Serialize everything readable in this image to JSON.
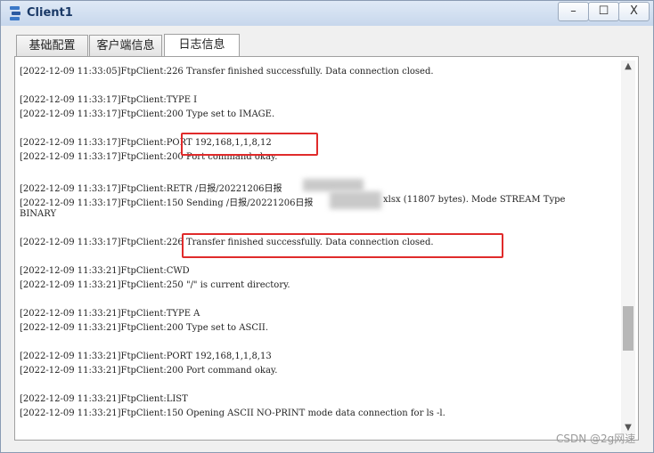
{
  "window": {
    "title": "Client1",
    "minimize_glyph": "–",
    "maximize_glyph": "☐",
    "close_glyph": "X"
  },
  "tabs": [
    {
      "label": "基础配置"
    },
    {
      "label": "客户端信息"
    },
    {
      "label": "日志信息"
    }
  ],
  "log_lines": [
    "[2022-12-09 11:33:05]FtpClient:226 Transfer finished successfully. Data connection closed.",
    "[2022-12-09 11:33:17]FtpClient:TYPE I",
    "[2022-12-09 11:33:17]FtpClient:200 Type set to IMAGE.",
    "[2022-12-09 11:33:17]FtpClient:PORT 192,168,1,1,8,12",
    "[2022-12-09 11:33:17]FtpClient:200 Port command okay.",
    "[2022-12-09 11:33:17]FtpClient:RETR /日报/20221206日报",
    "[2022-12-09 11:33:17]FtpClient:150 Sending /日报/20221206日报",
    " xlsx (11807 bytes). Mode STREAM Type",
    "BINARY",
    "[2022-12-09 11:33:17]FtpClient:226 Transfer finished successfully. Data connection closed.",
    "[2022-12-09 11:33:21]FtpClient:CWD",
    "[2022-12-09 11:33:21]FtpClient:250 \"/\" is current directory.",
    "[2022-12-09 11:33:21]FtpClient:TYPE A",
    "[2022-12-09 11:33:21]FtpClient:200 Type set to ASCII.",
    "[2022-12-09 11:33:21]FtpClient:PORT 192,168,1,1,8,13",
    "[2022-12-09 11:33:21]FtpClient:200 Port command okay.",
    "[2022-12-09 11:33:21]FtpClient:LIST",
    "[2022-12-09 11:33:21]FtpClient:150 Opening ASCII NO-PRINT mode data connection for ls -l."
  ],
  "scrollbar": {
    "up_glyph": "▲",
    "down_glyph": "▼"
  },
  "watermark": "CSDN @2g网速",
  "colors": {
    "highlight": "#e02b2b",
    "titlebar": "#c7d7ec"
  }
}
